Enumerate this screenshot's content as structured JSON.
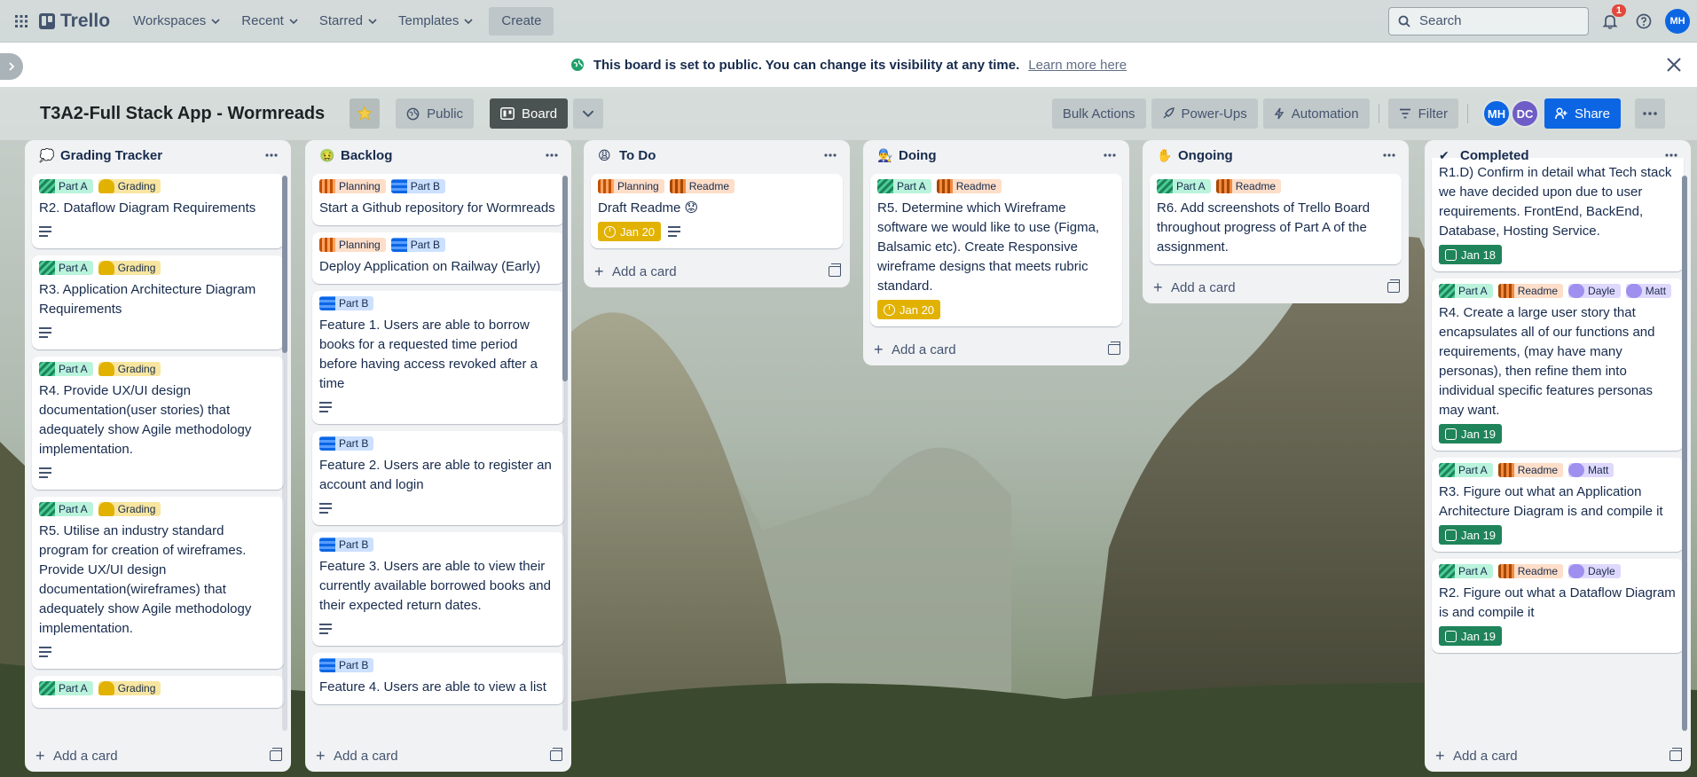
{
  "topnav": {
    "brand": "Trello",
    "menus": [
      {
        "label": "Workspaces"
      },
      {
        "label": "Recent"
      },
      {
        "label": "Starred"
      },
      {
        "label": "Templates"
      }
    ],
    "create_label": "Create",
    "search_placeholder": "Search",
    "notification_count": "1",
    "user_initials": "MH"
  },
  "banner": {
    "text": "This board is set to public. You can change its visibility at any time.",
    "link": "Learn more here"
  },
  "board": {
    "title": "T3A2-Full Stack App - Wormreads",
    "visibility": "Public",
    "view": "Board",
    "bulk_actions": "Bulk Actions",
    "power_ups": "Power-Ups",
    "automation": "Automation",
    "filter": "Filter",
    "members": [
      "MH",
      "DC"
    ],
    "share": "Share"
  },
  "add_card_label": "Add a card",
  "lists": [
    {
      "title": "Grading Tracker",
      "emoji": "💭",
      "cards": [
        {
          "labels": [
            {
              "t": "Part A",
              "c": "parta"
            },
            {
              "t": "Grading",
              "c": "grading"
            }
          ],
          "title": "R2. Dataflow Diagram Requirements",
          "desc": true
        },
        {
          "labels": [
            {
              "t": "Part A",
              "c": "parta"
            },
            {
              "t": "Grading",
              "c": "grading"
            }
          ],
          "title": "R3. Application Architecture Diagram Requirements",
          "desc": true
        },
        {
          "labels": [
            {
              "t": "Part A",
              "c": "parta"
            },
            {
              "t": "Grading",
              "c": "grading"
            }
          ],
          "title": "R4. Provide UX/UI design documentation(user stories) that adequately show Agile methodology implementation.",
          "desc": true
        },
        {
          "labels": [
            {
              "t": "Part A",
              "c": "parta"
            },
            {
              "t": "Grading",
              "c": "grading"
            }
          ],
          "title": "R5. Utilise an industry standard program for creation of wireframes. Provide UX/UI design documentation(wireframes) that adequately show Agile methodology implementation.",
          "desc": true
        },
        {
          "labels": [
            {
              "t": "Part A",
              "c": "parta"
            },
            {
              "t": "Grading",
              "c": "grading"
            }
          ],
          "title": "",
          "desc": false
        }
      ]
    },
    {
      "title": "Backlog",
      "emoji": "🤢",
      "cards": [
        {
          "labels": [
            {
              "t": "Planning",
              "c": "planning"
            },
            {
              "t": "Part B",
              "c": "partb"
            }
          ],
          "title": "Start a Github repository for Wormreads",
          "desc": false
        },
        {
          "labels": [
            {
              "t": "Planning",
              "c": "planning"
            },
            {
              "t": "Part B",
              "c": "partb"
            }
          ],
          "title": "Deploy Application on Railway (Early)",
          "desc": false
        },
        {
          "labels": [
            {
              "t": "Part B",
              "c": "partb"
            }
          ],
          "title": "Feature 1. Users are able to borrow books for a requested time period before having access revoked after a time",
          "desc": true
        },
        {
          "labels": [
            {
              "t": "Part B",
              "c": "partb"
            }
          ],
          "title": "Feature 2. Users are able to register an account and login",
          "desc": true
        },
        {
          "labels": [
            {
              "t": "Part B",
              "c": "partb"
            }
          ],
          "title": "Feature 3. Users are able to view their currently available borrowed books and their expected return dates.",
          "desc": true
        },
        {
          "labels": [
            {
              "t": "Part B",
              "c": "partb"
            }
          ],
          "title": "Feature 4. Users are able to view a list",
          "desc": false
        }
      ]
    },
    {
      "title": "To Do",
      "emoji": "😩",
      "cards": [
        {
          "labels": [
            {
              "t": "Planning",
              "c": "planning"
            },
            {
              "t": "Readme",
              "c": "readme"
            }
          ],
          "title": "Draft Readme 😟",
          "due": "Jan 20",
          "due_color": "yellow",
          "desc": true
        }
      ]
    },
    {
      "title": "Doing",
      "emoji": "👨‍🔧",
      "cards": [
        {
          "labels": [
            {
              "t": "Part A",
              "c": "parta"
            },
            {
              "t": "Readme",
              "c": "readme"
            }
          ],
          "title": "R5. Determine which Wireframe software we would like to use (Figma, Balsamic etc). Create Responsive wireframe designs that meets rubric standard.",
          "due": "Jan 20",
          "due_color": "yellow",
          "desc": false
        }
      ]
    },
    {
      "title": "Ongoing",
      "emoji": "✋",
      "cards": [
        {
          "labels": [
            {
              "t": "Part A",
              "c": "parta"
            },
            {
              "t": "Readme",
              "c": "readme"
            }
          ],
          "title": "R6. Add screenshots of Trello Board throughout progress of Part A of the assignment.",
          "desc": false
        }
      ]
    },
    {
      "title": "Completed",
      "emoji": "✔",
      "cards": [
        {
          "labels": [],
          "title": "R1.D) Confirm in detail what Tech stack we have decided upon due to user requirements. FrontEnd, BackEnd, Database, Hosting Service.",
          "due": "Jan 18",
          "due_color": "green",
          "desc": false
        },
        {
          "labels": [
            {
              "t": "Part A",
              "c": "parta"
            },
            {
              "t": "Readme",
              "c": "readme"
            },
            {
              "t": "Dayle",
              "c": "member"
            },
            {
              "t": "Matt",
              "c": "member"
            }
          ],
          "title": "R4. Create a large user story that encapsulates all of our functions and requirements, (may have many personas), then refine them into individual specific features personas may want.",
          "due": "Jan 19",
          "due_color": "green",
          "desc": false
        },
        {
          "labels": [
            {
              "t": "Part A",
              "c": "parta"
            },
            {
              "t": "Readme",
              "c": "readme"
            },
            {
              "t": "Matt",
              "c": "member"
            }
          ],
          "title": "R3. Figure out what an Application Architecture Diagram is and compile it",
          "due": "Jan 19",
          "due_color": "green",
          "desc": false
        },
        {
          "labels": [
            {
              "t": "Part A",
              "c": "parta"
            },
            {
              "t": "Readme",
              "c": "readme"
            },
            {
              "t": "Dayle",
              "c": "member"
            }
          ],
          "title": "R2. Figure out what a Dataflow Diagram is and compile it",
          "due": "Jan 19",
          "due_color": "green",
          "desc": false
        }
      ]
    }
  ]
}
